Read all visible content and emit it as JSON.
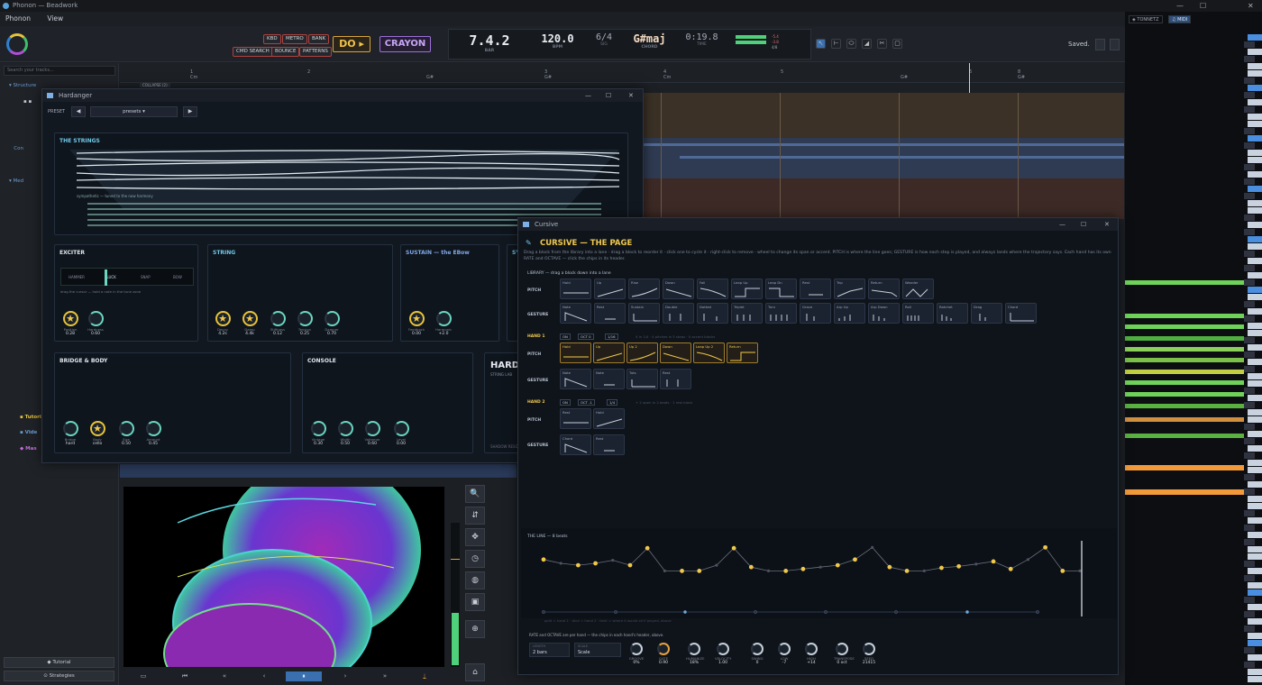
{
  "window": {
    "title": "Phonon — Beadwork",
    "controls": [
      "—",
      "☐",
      "✕"
    ]
  },
  "menu": [
    "Phonon",
    "View"
  ],
  "toolbar": {
    "buttons_row1": [
      "KBD",
      "METRO",
      "BANK"
    ],
    "buttons_row2": [
      "CMD SEARCH",
      "BOUNCE",
      "PATTERNS"
    ],
    "do_label": "DO ▸",
    "crayon_label": "CRAYON",
    "saved": "Saved.",
    "tool_icons": [
      "↖",
      "⊢",
      "⬭",
      "◢",
      "✂",
      "▢"
    ]
  },
  "transport": {
    "position": "7.4.2",
    "position_unit": "BAR",
    "tempo": "120.0",
    "tempo_unit": "BPM",
    "meter": "6/4",
    "meter_unit": "SIG",
    "chord": "G#maj",
    "chord_unit": "CHORD",
    "time": "0:19.8",
    "time_unit": "TIME",
    "meter_readouts": [
      "-5.4",
      "-3.8",
      "4/8"
    ]
  },
  "sidebar": {
    "search_placeholder": "Search your tracks...",
    "tree": [
      "Structure",
      "Con",
      "Med",
      "Tutori",
      "Vide",
      "Mas"
    ],
    "tutorial": "◆ Tutorial",
    "strategies": "⊙ Strategies"
  },
  "timeline": {
    "ticks": [
      {
        "num": "1",
        "chord": "Cm"
      },
      {
        "num": "2",
        "chord": ""
      },
      {
        "num": "",
        "chord": "G#"
      },
      {
        "num": "3",
        "chord": "G#"
      },
      {
        "num": "4",
        "chord": "Cm"
      },
      {
        "num": "5",
        "chord": ""
      },
      {
        "num": "",
        "chord": "G#"
      },
      {
        "num": "6",
        "chord": ""
      },
      {
        "num": "8",
        "chord": "G#"
      }
    ],
    "collapse": "COLLAPSE (2)"
  },
  "right_panel": {
    "tab_tonnetz": "◈ TONNETZ",
    "tab_midi": "♫ MIDI"
  },
  "hardanger": {
    "title": "Hardanger",
    "preset_label": "PRESET",
    "preset_value": "presets ▾",
    "strings_title": "THE STRINGS",
    "strings_note": "sympathetic — tuned to the now harmony",
    "exciter": {
      "title": "EXCITER",
      "modes": [
        "HAMMER",
        "PLUCK",
        "SNAP",
        "BOW"
      ],
      "hint": "drag the cursor — hold a note in the tune zone",
      "knobs": [
        {
          "label": "Position",
          "value": "0.28",
          "star": true
        },
        {
          "label": "Hardness",
          "value": "0.60",
          "star": false
        }
      ]
    },
    "string": {
      "title": "STRING",
      "knobs": [
        {
          "label": "Decay",
          "value": "4.2s",
          "star": true
        },
        {
          "label": "Damp",
          "value": "4.4k",
          "star": true
        },
        {
          "label": "Stiffness",
          "value": "0.12",
          "star": false
        },
        {
          "label": "Tension",
          "value": "0.25",
          "star": false
        },
        {
          "label": "Damper",
          "value": "0.70",
          "star": false
        }
      ]
    },
    "sustain": {
      "title": "SUSTAIN — the EBow",
      "knobs": [
        {
          "label": "Feedback",
          "value": "0.00",
          "star": true
        },
        {
          "label": "Harmonic",
          "value": "+2.0",
          "star": false
        }
      ]
    },
    "sym_title": "SYM",
    "bridge": {
      "title": "BRIDGE & BODY",
      "knobs": [
        {
          "label": "Bridge",
          "value": "hard",
          "star": false
        },
        {
          "label": "Body",
          "value": "cello",
          "star": true
        },
        {
          "label": "Size",
          "value": "0.50",
          "star": false
        },
        {
          "label": "Amount",
          "value": "0.45",
          "star": false
        }
      ]
    },
    "console": {
      "title": "CONSOLE",
      "knobs": [
        {
          "label": "Vintage",
          "value": "0.30",
          "star": false
        },
        {
          "label": "Width",
          "value": "0.50",
          "star": false
        },
        {
          "label": "Voltemar",
          "value": "0.60",
          "star": false
        },
        {
          "label": "Level",
          "value": "0.00",
          "star": false
        }
      ]
    },
    "harda_title": "HARDA",
    "harda_sub": "STRING LAB",
    "harda_foot": "SHADOW RESO"
  },
  "cursive": {
    "title": "Cursive",
    "heading": "CURSIVE — THE PAGE",
    "intro": "Drag a block from the library into a lane · drag a block to reorder it · click one to cycle it · right-click to remove · wheel to change its span or accent. PITCH is where the line goes; GESTURE is how each step is played, and always lands where the trajectory says. Each hand has its own RATE and OCTAVE — click the chips in its header.",
    "library_label": "LIBRARY — drag a block down into a lane",
    "pitch_label": "PITCH",
    "gesture_label": "GESTURE",
    "library_pitch": [
      "Hold",
      "Up",
      "Rise",
      "Down",
      "Fall",
      "Leap Up",
      "Leap Dn",
      "Rest",
      "Trip",
      "Return",
      "Wander"
    ],
    "library_gesture": [
      "Note",
      "Rest",
      "Sustain",
      "Double",
      "Dotted",
      "Triplet",
      "Turn",
      "Grace",
      "Arp Up",
      "Arp Down",
      "Roll",
      "Ratchet",
      "Drag",
      "Chord"
    ],
    "hand1": {
      "label": "HAND 1",
      "chips": [
        "ON",
        "OCT 0",
        "1/16"
      ],
      "hint": "4 in 1/4 · 4 pitches in 5 steps · 0 accent blocks",
      "pitch": [
        "Hold",
        "Up",
        "Up 2",
        "Down",
        "Leap Up 2",
        "Return"
      ],
      "gesture": [
        "Note",
        "Note",
        "Tuts",
        "Rest"
      ]
    },
    "hand2": {
      "label": "HAND 2",
      "chips": [
        "ON",
        "OCT -1",
        "1/4"
      ],
      "hint": "+ 2 open in 2 beats · 1 rest block",
      "pitch": [
        "Rest",
        "Hold"
      ],
      "gesture": [
        "Chord",
        "Rest"
      ]
    },
    "line_label": "THE LINE — 8 beats",
    "line_caption": "gold = hand 1 · blue = hand 2 · faint = where it would sit if played, above",
    "line_h1": [
      0.6,
      0.5,
      0.45,
      0.5,
      0.58,
      0.45,
      0.9,
      0.3,
      0.3,
      0.3,
      0.45,
      0.9,
      0.4,
      0.3,
      0.3,
      0.35,
      0.4,
      0.45,
      0.6,
      0.92,
      0.4,
      0.3,
      0.3,
      0.38,
      0.42,
      0.48,
      0.55,
      0.35,
      0.6,
      0.92,
      0.3,
      0.3
    ],
    "rate_note": "RATE and OCTAVE are per hand — the chips in each hand's header, above.",
    "length_label": "LENGTH",
    "length_value": "2 bars",
    "scale_label": "SCALE",
    "scale_value": "Scale",
    "knobs": [
      {
        "label": "GROOVE",
        "value": "0%"
      },
      {
        "label": "GATE",
        "value": "0.90"
      },
      {
        "label": "HUMANIZE",
        "value": "18%"
      },
      {
        "label": "VELOCITY",
        "value": "1.00"
      },
      {
        "label": "SWING",
        "value": "0"
      },
      {
        "label": "LOW",
        "value": "-7"
      },
      {
        "label": "HIGH",
        "value": "+14"
      },
      {
        "label": "TRANSPOSE",
        "value": "0 oct"
      },
      {
        "label": "SEED",
        "value": "21415"
      }
    ]
  },
  "visualizer": {
    "tools": [
      "🔍",
      "⇵",
      "✥",
      "◷",
      "◍",
      "▣",
      "⊕",
      "⌂"
    ]
  },
  "bottom_bar": [
    "▭",
    "⏮",
    "«",
    "‹",
    "⏸",
    "›",
    "»",
    "⍊"
  ],
  "colors": {
    "accent_gold": "#f0c84b",
    "accent_teal": "#6ad6c0",
    "accent_purple": "#b04fd6",
    "hand2_blue": "#6aaee0"
  }
}
